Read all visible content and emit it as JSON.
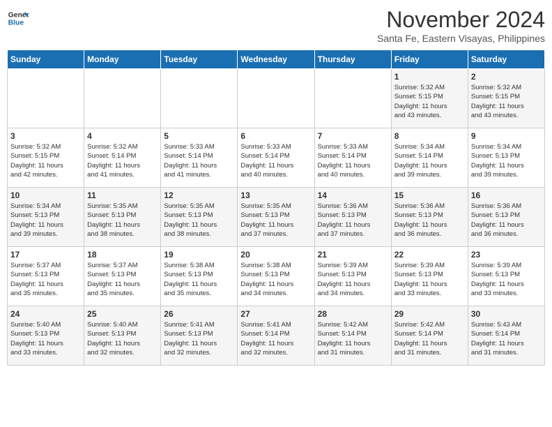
{
  "header": {
    "logo_line1": "General",
    "logo_line2": "Blue",
    "month": "November 2024",
    "location": "Santa Fe, Eastern Visayas, Philippines"
  },
  "days_of_week": [
    "Sunday",
    "Monday",
    "Tuesday",
    "Wednesday",
    "Thursday",
    "Friday",
    "Saturday"
  ],
  "weeks": [
    [
      {
        "day": "",
        "info": ""
      },
      {
        "day": "",
        "info": ""
      },
      {
        "day": "",
        "info": ""
      },
      {
        "day": "",
        "info": ""
      },
      {
        "day": "",
        "info": ""
      },
      {
        "day": "1",
        "info": "Sunrise: 5:32 AM\nSunset: 5:15 PM\nDaylight: 11 hours\nand 43 minutes."
      },
      {
        "day": "2",
        "info": "Sunrise: 5:32 AM\nSunset: 5:15 PM\nDaylight: 11 hours\nand 43 minutes."
      }
    ],
    [
      {
        "day": "3",
        "info": "Sunrise: 5:32 AM\nSunset: 5:15 PM\nDaylight: 11 hours\nand 42 minutes."
      },
      {
        "day": "4",
        "info": "Sunrise: 5:32 AM\nSunset: 5:14 PM\nDaylight: 11 hours\nand 41 minutes."
      },
      {
        "day": "5",
        "info": "Sunrise: 5:33 AM\nSunset: 5:14 PM\nDaylight: 11 hours\nand 41 minutes."
      },
      {
        "day": "6",
        "info": "Sunrise: 5:33 AM\nSunset: 5:14 PM\nDaylight: 11 hours\nand 40 minutes."
      },
      {
        "day": "7",
        "info": "Sunrise: 5:33 AM\nSunset: 5:14 PM\nDaylight: 11 hours\nand 40 minutes."
      },
      {
        "day": "8",
        "info": "Sunrise: 5:34 AM\nSunset: 5:14 PM\nDaylight: 11 hours\nand 39 minutes."
      },
      {
        "day": "9",
        "info": "Sunrise: 5:34 AM\nSunset: 5:13 PM\nDaylight: 11 hours\nand 39 minutes."
      }
    ],
    [
      {
        "day": "10",
        "info": "Sunrise: 5:34 AM\nSunset: 5:13 PM\nDaylight: 11 hours\nand 39 minutes."
      },
      {
        "day": "11",
        "info": "Sunrise: 5:35 AM\nSunset: 5:13 PM\nDaylight: 11 hours\nand 38 minutes."
      },
      {
        "day": "12",
        "info": "Sunrise: 5:35 AM\nSunset: 5:13 PM\nDaylight: 11 hours\nand 38 minutes."
      },
      {
        "day": "13",
        "info": "Sunrise: 5:35 AM\nSunset: 5:13 PM\nDaylight: 11 hours\nand 37 minutes."
      },
      {
        "day": "14",
        "info": "Sunrise: 5:36 AM\nSunset: 5:13 PM\nDaylight: 11 hours\nand 37 minutes."
      },
      {
        "day": "15",
        "info": "Sunrise: 5:36 AM\nSunset: 5:13 PM\nDaylight: 11 hours\nand 36 minutes."
      },
      {
        "day": "16",
        "info": "Sunrise: 5:36 AM\nSunset: 5:13 PM\nDaylight: 11 hours\nand 36 minutes."
      }
    ],
    [
      {
        "day": "17",
        "info": "Sunrise: 5:37 AM\nSunset: 5:13 PM\nDaylight: 11 hours\nand 35 minutes."
      },
      {
        "day": "18",
        "info": "Sunrise: 5:37 AM\nSunset: 5:13 PM\nDaylight: 11 hours\nand 35 minutes."
      },
      {
        "day": "19",
        "info": "Sunrise: 5:38 AM\nSunset: 5:13 PM\nDaylight: 11 hours\nand 35 minutes."
      },
      {
        "day": "20",
        "info": "Sunrise: 5:38 AM\nSunset: 5:13 PM\nDaylight: 11 hours\nand 34 minutes."
      },
      {
        "day": "21",
        "info": "Sunrise: 5:39 AM\nSunset: 5:13 PM\nDaylight: 11 hours\nand 34 minutes."
      },
      {
        "day": "22",
        "info": "Sunrise: 5:39 AM\nSunset: 5:13 PM\nDaylight: 11 hours\nand 33 minutes."
      },
      {
        "day": "23",
        "info": "Sunrise: 5:39 AM\nSunset: 5:13 PM\nDaylight: 11 hours\nand 33 minutes."
      }
    ],
    [
      {
        "day": "24",
        "info": "Sunrise: 5:40 AM\nSunset: 5:13 PM\nDaylight: 11 hours\nand 33 minutes."
      },
      {
        "day": "25",
        "info": "Sunrise: 5:40 AM\nSunset: 5:13 PM\nDaylight: 11 hours\nand 32 minutes."
      },
      {
        "day": "26",
        "info": "Sunrise: 5:41 AM\nSunset: 5:13 PM\nDaylight: 11 hours\nand 32 minutes."
      },
      {
        "day": "27",
        "info": "Sunrise: 5:41 AM\nSunset: 5:14 PM\nDaylight: 11 hours\nand 32 minutes."
      },
      {
        "day": "28",
        "info": "Sunrise: 5:42 AM\nSunset: 5:14 PM\nDaylight: 11 hours\nand 31 minutes."
      },
      {
        "day": "29",
        "info": "Sunrise: 5:42 AM\nSunset: 5:14 PM\nDaylight: 11 hours\nand 31 minutes."
      },
      {
        "day": "30",
        "info": "Sunrise: 5:43 AM\nSunset: 5:14 PM\nDaylight: 11 hours\nand 31 minutes."
      }
    ]
  ]
}
